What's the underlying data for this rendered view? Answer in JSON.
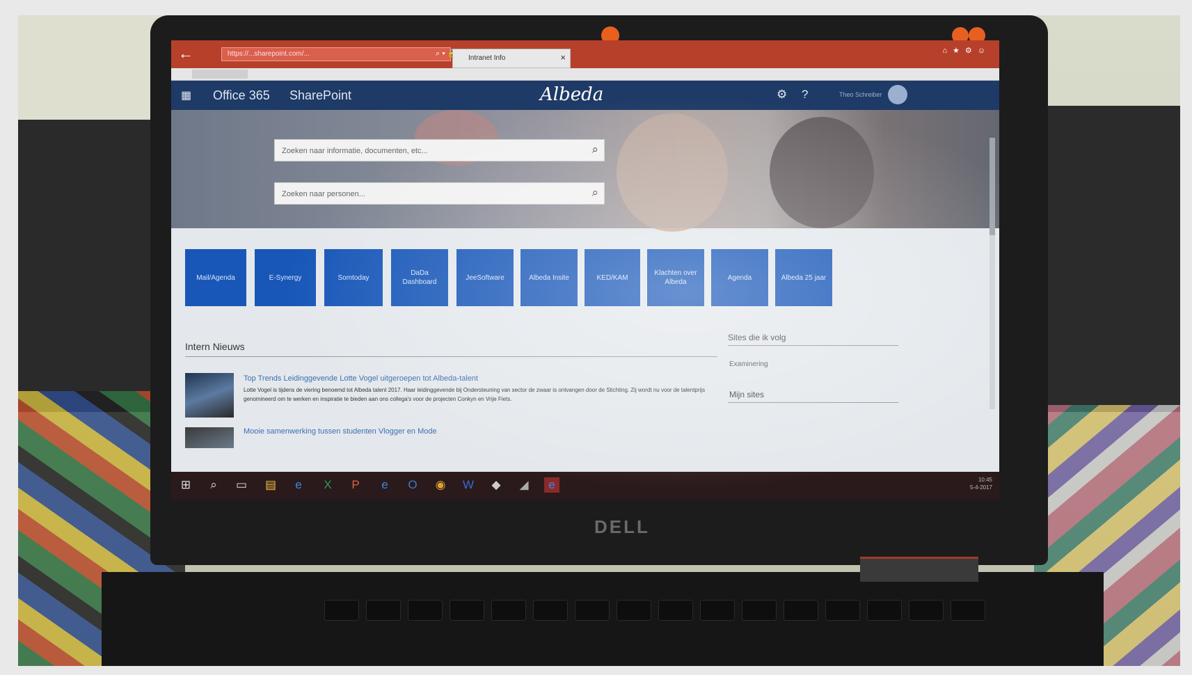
{
  "browser": {
    "back_glyph": "←",
    "address_text": "https://...sharepoint.com/...",
    "address_icons": "⌕ ▾ 🔒 ↻",
    "tab_label": "Intranet Info",
    "tab_close_glyph": "×",
    "window_controls": "⌂★⚙☺"
  },
  "o365": {
    "product_label": "Office 365",
    "app_label": "SharePoint",
    "brand_logo_text": "Albeda",
    "waffle_glyph": "▦",
    "gear_glyph": "⚙",
    "help_glyph": "?",
    "user_name": "Theo Schreiber"
  },
  "search": {
    "documents_placeholder": "Zoeken naar informatie, documenten, etc...",
    "people_placeholder": "Zoeken naar personen...",
    "icon_glyph": "⌕"
  },
  "tiles": [
    {
      "label": "Mail/Agenda"
    },
    {
      "label": "E-Synergy"
    },
    {
      "label": "Somtoday"
    },
    {
      "label": "DaDa Dashboard"
    },
    {
      "label": "JeeSoftware"
    },
    {
      "label": "Albeda Insite"
    },
    {
      "label": "KED/KAM"
    },
    {
      "label": "Klachten over Albeda"
    },
    {
      "label": "Agenda"
    },
    {
      "label": "Albeda 25 jaar"
    }
  ],
  "news": {
    "heading": "Intern Nieuws",
    "item1_title": "Top Trends Leidinggevende Lotte Vogel uitgeroepen tot Albeda-talent",
    "item1_body": "Lotte Vogel is tijdens de viering benoemd tot Albeda talent 2017. Haar leidinggevende bij Ondersteuning van sector de zwaar is ontvangen door de Stichting. Zij wordt nu voor de talentprijs genomineerd om te werken en inspiratie te bieden aan ons collega's voor de projecten Conkyn en Vrije Fiets.",
    "item2_title": "Mooie samenwerking tussen studenten Vlogger en Mode"
  },
  "sites": {
    "heading": "Sites die ik volg",
    "item": "Examinering",
    "my_sites": "Mijn sites"
  },
  "taskbar": {
    "start_glyph": "⊞",
    "search_glyph": "⌕",
    "taskview_glyph": "▭",
    "explorer_glyph": "▤",
    "edge_glyph": "e",
    "excel_glyph": "X",
    "ppt_glyph": "P",
    "ie_glyph": "e",
    "outlook_glyph": "O",
    "chrome_glyph": "◉",
    "word_glyph": "W",
    "other_glyph": "◆",
    "bird_glyph": "◢",
    "ie_active_glyph": "e",
    "time": "10:45",
    "date": "5-4-2017"
  },
  "laptop": {
    "brand": "DELL"
  },
  "colors": {
    "o365_bar": "#1e3a66",
    "tile_blue": "#1857b8",
    "browser_accent": "#b7402a"
  }
}
